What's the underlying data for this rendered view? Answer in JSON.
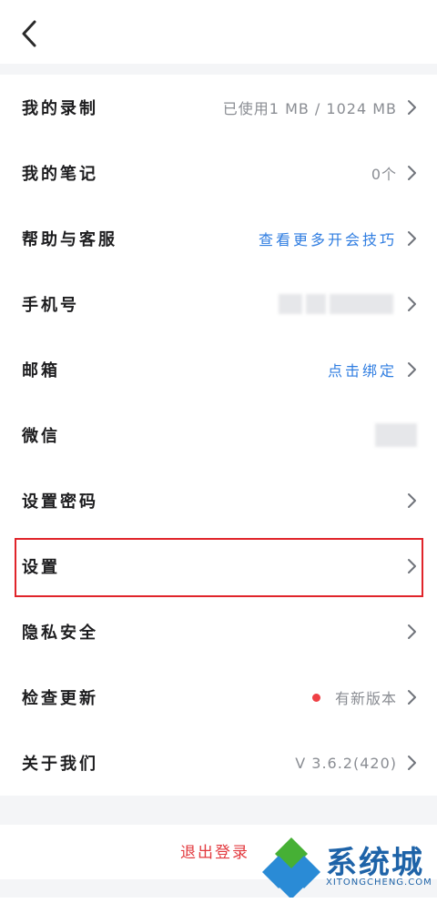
{
  "header": {
    "back_icon": "chevron-left-icon"
  },
  "menu": [
    {
      "key": "recordings",
      "label": "我的录制",
      "value": "已使用1 MB / 1024 MB",
      "value_style": "gray"
    },
    {
      "key": "notes",
      "label": "我的笔记",
      "value": "0个",
      "value_style": "gray"
    },
    {
      "key": "help",
      "label": "帮助与客服",
      "value": "查看更多开会技巧",
      "value_style": "link"
    },
    {
      "key": "phone",
      "label": "手机号",
      "value": "",
      "value_style": "blurred"
    },
    {
      "key": "email",
      "label": "邮箱",
      "value": "点击绑定",
      "value_style": "link"
    },
    {
      "key": "wechat",
      "label": "微信",
      "value": "",
      "value_style": "blurred"
    },
    {
      "key": "password",
      "label": "设置密码",
      "value": ""
    },
    {
      "key": "settings",
      "label": "设置",
      "value": "",
      "highlighted": true
    },
    {
      "key": "privacy",
      "label": "隐私安全",
      "value": ""
    },
    {
      "key": "update",
      "label": "检查更新",
      "value": "有新版本",
      "value_style": "gray",
      "badge": "red-dot"
    },
    {
      "key": "about",
      "label": "关于我们",
      "value": "V 3.6.2(420)",
      "value_style": "gray"
    }
  ],
  "logout": {
    "label": "退出登录"
  },
  "watermark": {
    "title": "系统城",
    "subtitle": "XITONGCHENG.COM"
  },
  "colors": {
    "accent_link": "#2f7de1",
    "highlight_border": "#e0242a",
    "logout_text": "#e2393e",
    "badge_dot": "#ef4045",
    "section_gap": "#f4f5f7"
  }
}
